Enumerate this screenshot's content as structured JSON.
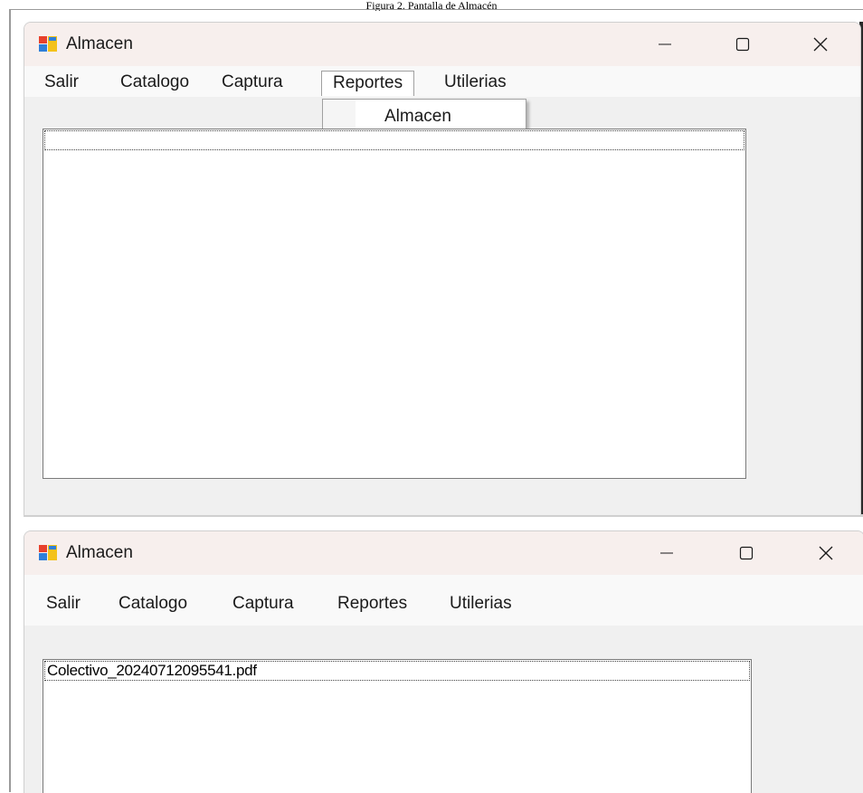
{
  "caption": "Figura 2. Pantalla de Almacén",
  "colors": {
    "titlebar": "#f7efed",
    "menubar": "#f9f9f9",
    "client_area": "#f0f0f0",
    "list_background": "#ffffff",
    "list_border": "#7a7a7a",
    "icon_red": "#e8412c",
    "icon_blue": "#2f7fd9",
    "icon_yellow": "#f4c21a"
  },
  "window1": {
    "title": "Almacen",
    "app_icon": "winforms-app-icon",
    "controls": {
      "minimize_icon": "minimize-icon",
      "maximize_icon": "maximize-icon",
      "close_icon": "close-icon"
    },
    "menu": [
      {
        "label": "Salir"
      },
      {
        "label": "Catalogo"
      },
      {
        "label": "Captura"
      },
      {
        "label": "Reportes",
        "open": true
      },
      {
        "label": "Utilerias"
      }
    ],
    "dropdown": {
      "parent": "Reportes",
      "items": [
        {
          "label": "Almacen"
        }
      ]
    },
    "listbox": {
      "items": [
        {
          "label": ""
        }
      ]
    }
  },
  "window2": {
    "title": "Almacen",
    "app_icon": "winforms-app-icon",
    "controls": {
      "minimize_icon": "minimize-icon",
      "maximize_icon": "maximize-icon",
      "close_icon": "close-icon"
    },
    "menu": [
      {
        "label": "Salir"
      },
      {
        "label": "Catalogo"
      },
      {
        "label": "Captura"
      },
      {
        "label": "Reportes"
      },
      {
        "label": "Utilerias"
      }
    ],
    "listbox": {
      "items": [
        {
          "label": "Colectivo_20240712095541.pdf"
        }
      ]
    }
  }
}
